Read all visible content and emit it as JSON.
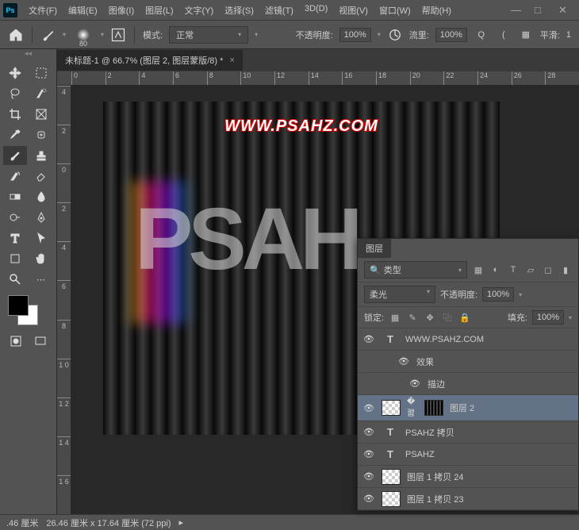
{
  "menu": {
    "items": [
      "文件(F)",
      "编辑(E)",
      "图像(I)",
      "图层(L)",
      "文字(Y)",
      "选择(S)",
      "滤镜(T)",
      "3D(D)",
      "视图(V)",
      "窗口(W)",
      "帮助(H)"
    ]
  },
  "options": {
    "brush_size": "80",
    "mode_label": "模式:",
    "mode_value": "正常",
    "opacity_label": "不透明度:",
    "opacity_value": "100%",
    "flow_label": "流里:",
    "flow_value": "100%",
    "smoothing_label": "平滑:",
    "smoothing_value": "1"
  },
  "document": {
    "tab_title": "未标题-1 @ 66.7% (图层 2, 图层蒙版/8) *"
  },
  "rulers": {
    "h": [
      "0",
      "2",
      "4",
      "6",
      "8",
      "10",
      "12",
      "14",
      "16",
      "18",
      "20",
      "22",
      "24",
      "26",
      "28"
    ],
    "v": [
      "4",
      "2",
      "0",
      "2",
      "4",
      "6",
      "8",
      "1 0",
      "1 2",
      "1 4",
      "1 6"
    ]
  },
  "canvas": {
    "watermark": "WWW.PSAHZ.COM",
    "big_text": "PSAH"
  },
  "layers_panel": {
    "title": "图层",
    "search_placeholder": "类型",
    "blend_mode": "柔光",
    "opacity_label": "不透明度:",
    "opacity_value": "100%",
    "lock_label": "锁定:",
    "fill_label": "填充:",
    "fill_value": "100%",
    "layers": [
      {
        "type": "T",
        "name": "WWW.PSAHZ.COM",
        "visible": true
      },
      {
        "type": "fx",
        "name": "效果",
        "visible": true,
        "indent": 1
      },
      {
        "type": "fx",
        "name": "描边",
        "visible": true,
        "indent": 2
      },
      {
        "type": "mask",
        "name": "图层 2",
        "visible": true,
        "selected": true
      },
      {
        "type": "T",
        "name": "PSAHZ 拷贝",
        "visible": true
      },
      {
        "type": "T",
        "name": "PSAHZ",
        "visible": true
      },
      {
        "type": "img",
        "name": "图层 1 拷贝 24",
        "visible": true
      },
      {
        "type": "img",
        "name": "图层 1 拷贝 23",
        "visible": true
      }
    ]
  },
  "status": {
    "zoom": ".46 厘米",
    "dims": "26.46 厘米 x 17.64 厘米 (72 ppi)"
  }
}
